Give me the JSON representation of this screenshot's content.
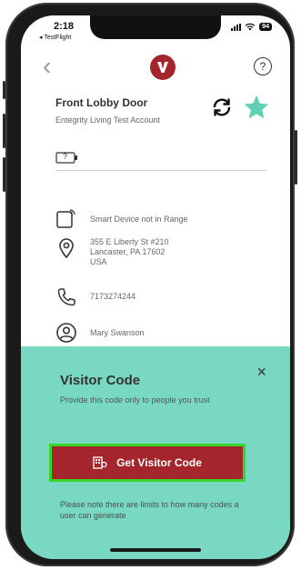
{
  "status": {
    "time": "2:18",
    "back_app": "◂ TestFlight",
    "battery": "94"
  },
  "header": {
    "back_glyph": "‹",
    "help_glyph": "?"
  },
  "device": {
    "name": "Front Lobby Door",
    "account": "Entegrity Living Test Account",
    "battery_glyph": "?"
  },
  "details": {
    "range_status": "Smart Device not in Range",
    "address_line1": "355 E Liberty St #210",
    "address_line2": "Lancaster, PA 17602",
    "address_line3": "USA",
    "phone": "7173274244",
    "contact_name": "Mary Swanson"
  },
  "visitor_sheet": {
    "title": "Visitor Code",
    "subtitle": "Provide this code only to people you trust",
    "close_glyph": "×",
    "button_label": "Get Visitor Code",
    "note": "Please note there are limits to how many codes a user can generate"
  },
  "colors": {
    "brand": "#a4262c",
    "accent": "#78d8c2",
    "button_outline": "#37d62a"
  },
  "icons": {
    "sync": "sync-icon",
    "favorite": "star-icon",
    "range": "smart-device-icon",
    "location": "location-pin-icon",
    "phone": "phone-icon",
    "contact": "person-icon",
    "code": "visitor-code-icon"
  }
}
